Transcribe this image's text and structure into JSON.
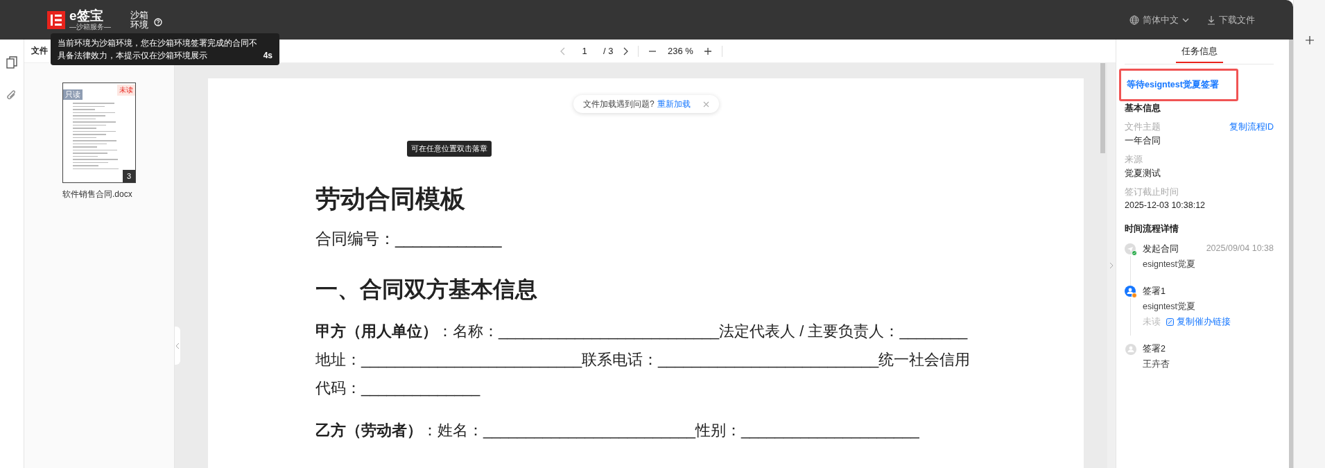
{
  "header": {
    "brand": "e签宝",
    "brand_sub": "—沙箱服务—",
    "env_label": [
      "沙箱",
      "环境"
    ],
    "language": "简体中文",
    "download": "下载文件"
  },
  "sandbox_notice": {
    "text": "当前环境为沙箱环境，您在沙箱环境签署完成的合同不具备法律效力，本提示仅在沙箱环境展示",
    "countdown": "4s"
  },
  "toolbar": {
    "files_label": "文件",
    "page": "1",
    "page_total": "/ 3",
    "zoom": "236 %"
  },
  "file_list": [
    {
      "name": "软件销售合同.docx",
      "read_only_tag": "只读",
      "unread_tag": "未读",
      "pages": "3",
      "selected": true
    }
  ],
  "load_notice": {
    "text": "文件加载遇到问题?",
    "action": "重新加载"
  },
  "stamp_hint": "可在任意位置双击落章",
  "document": {
    "title": "劳动合同模板",
    "contract_no": "合同编号：____________",
    "section": "一、合同双方基本信息",
    "paragraphs": [
      "**甲方（用人单位）**：名称：__________________________法定代表人 / 主要负责人：________地址：__________________________联系电话：__________________________统一社会信用代码：______________",
      "**乙方（劳动者）**：姓名：_________________________性别：_____________________"
    ]
  },
  "side_panel": {
    "tab": "任务信息",
    "status": {
      "text": "等待esigntest觉夏签署",
      "highlighted": true
    },
    "section_title": "基本信息",
    "copy_flow_id": "复制流程ID",
    "fields": [
      {
        "label": "文件主题",
        "value": "一年合同"
      },
      {
        "label": "来源",
        "value": "觉夏测试"
      },
      {
        "label": "签订截止时间",
        "value": "2025-12-03 10:38:12"
      }
    ],
    "timeline_title": "时间流程详情",
    "timeline": [
      {
        "kind": "started",
        "title": "发起合同",
        "time": "2025/09/04 10:38",
        "person": "esigntest觉夏"
      },
      {
        "kind": "signing",
        "title": "签署1",
        "person": "esigntest觉夏",
        "read_state": "未读",
        "action": "复制催办链接"
      },
      {
        "kind": "waiting",
        "title": "签署2",
        "person": "王卉杏"
      }
    ]
  }
}
